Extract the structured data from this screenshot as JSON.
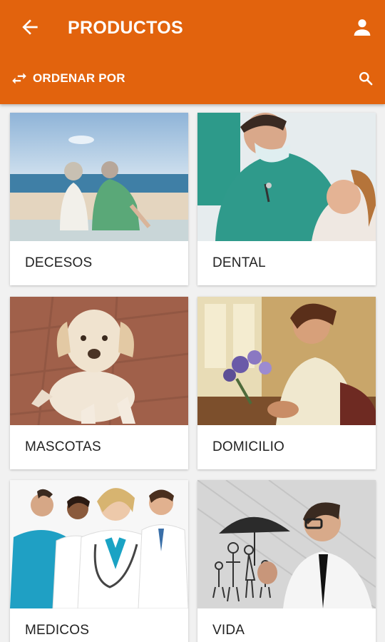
{
  "header": {
    "title": "PRODUCTOS",
    "sort_label": "ORDENAR POR",
    "icons": [
      "arrow-back-icon",
      "account-icon",
      "swap-icon",
      "search-icon"
    ]
  },
  "products": [
    {
      "label": "DECESOS"
    },
    {
      "label": "DENTAL"
    },
    {
      "label": "MASCOTAS"
    },
    {
      "label": "DOMICILIO"
    },
    {
      "label": "MEDICOS"
    },
    {
      "label": "VIDA"
    }
  ],
  "colors": {
    "primary": "#e2630d",
    "background": "#f1f1f1",
    "card": "#ffffff"
  }
}
